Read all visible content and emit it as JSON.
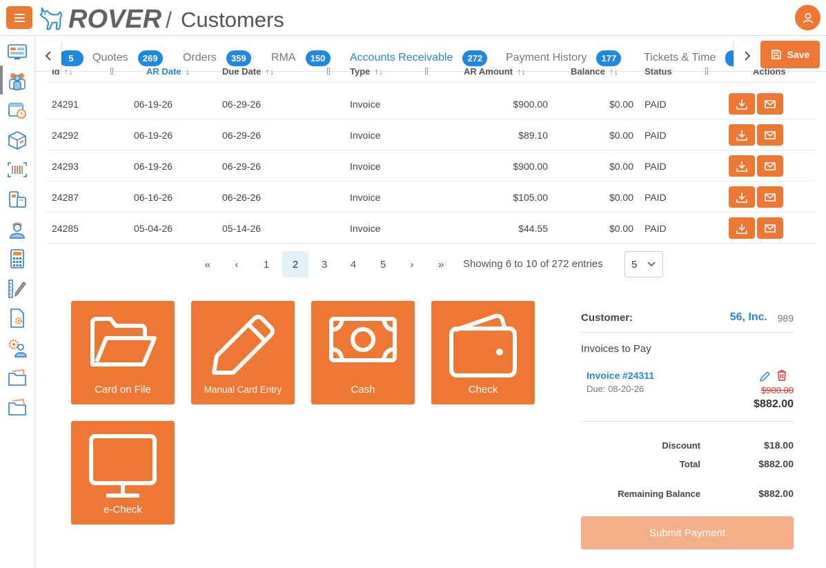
{
  "header": {
    "app_name": "ROVER",
    "separator": "/",
    "page_title": "Customers"
  },
  "tabs": [
    {
      "label": "",
      "count": "5"
    },
    {
      "label": "Quotes",
      "count": "269"
    },
    {
      "label": "Orders",
      "count": "359"
    },
    {
      "label": "RMA",
      "count": "150"
    },
    {
      "label": "Accounts Receivable",
      "count": "272",
      "active": true
    },
    {
      "label": "Payment History",
      "count": "177"
    },
    {
      "label": "Tickets & Time",
      "count": ""
    }
  ],
  "toolbar": {
    "save_label": "Save"
  },
  "table": {
    "columns": [
      "Id",
      "AR Date",
      "Due Date",
      "Type",
      "AR Amount",
      "Balance",
      "Status",
      "Actions"
    ],
    "rows": [
      {
        "id": "24291",
        "ar_date": "06-19-26",
        "due_date": "06-29-26",
        "type": "Invoice",
        "ar_amount": "$900.00",
        "balance": "$0.00",
        "status": "PAID"
      },
      {
        "id": "24292",
        "ar_date": "06-19-26",
        "due_date": "06-29-26",
        "type": "Invoice",
        "ar_amount": "$89.10",
        "balance": "$0.00",
        "status": "PAID"
      },
      {
        "id": "24293",
        "ar_date": "06-19-26",
        "due_date": "06-29-26",
        "type": "Invoice",
        "ar_amount": "$900.00",
        "balance": "$0.00",
        "status": "PAID"
      },
      {
        "id": "24287",
        "ar_date": "06-16-26",
        "due_date": "06-26-26",
        "type": "Invoice",
        "ar_amount": "$105.00",
        "balance": "$0.00",
        "status": "PAID"
      },
      {
        "id": "24285",
        "ar_date": "05-04-26",
        "due_date": "05-14-26",
        "type": "Invoice",
        "ar_amount": "$44.55",
        "balance": "$0.00",
        "status": "PAID"
      }
    ]
  },
  "pagination": {
    "first": "«",
    "prev": "‹",
    "pages": [
      "1",
      "2",
      "3",
      "4",
      "5"
    ],
    "current": "2",
    "next": "›",
    "last": "»",
    "showing": "Showing 6 to 10 of 272 entries",
    "page_size": "5"
  },
  "payment_methods": [
    {
      "label": "Card on File",
      "icon": "folder-icon"
    },
    {
      "label": "Manual Card Entry",
      "icon": "pencil-icon"
    },
    {
      "label": "Cash",
      "icon": "cash-icon"
    },
    {
      "label": "Check",
      "icon": "wallet-icon"
    },
    {
      "label": "e-Check",
      "icon": "monitor-icon"
    }
  ],
  "summary": {
    "customer_label": "Customer:",
    "customer_name": "56, Inc.",
    "customer_id": "989",
    "invoices_header": "Invoices to Pay",
    "invoice": {
      "link": "Invoice #24311",
      "due": "Due: 08-20-26",
      "original": "$900.00",
      "amount": "$882.00"
    },
    "discount_label": "Discount",
    "discount_value": "$18.00",
    "total_label": "Total",
    "total_value": "$882.00",
    "remaining_label": "Remaining Balance",
    "remaining_value": "$882.00",
    "submit_label": "Submit Payment"
  },
  "colors": {
    "accent": "#ee7733",
    "link": "#2487d0",
    "badge": "#1e88e5",
    "submit_disabled": "#f4ae88",
    "strike": "#e03030"
  }
}
